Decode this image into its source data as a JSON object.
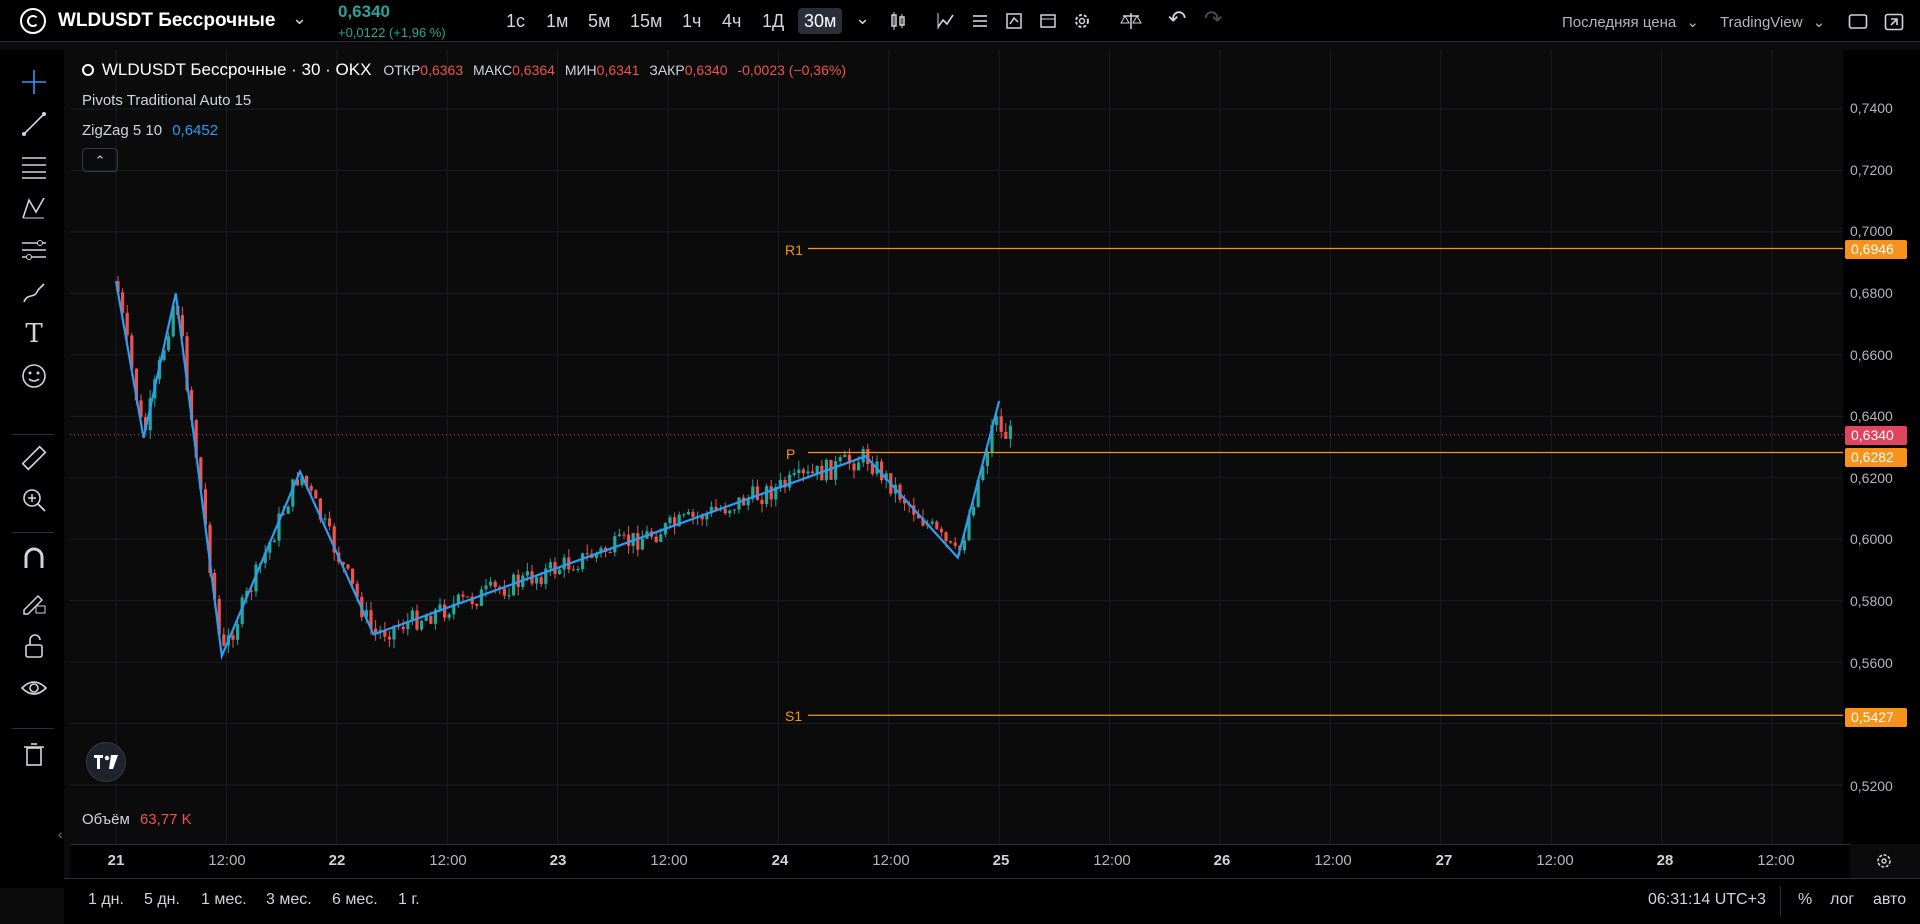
{
  "symbol": {
    "name": "WLDUSDT Бессрочные",
    "price": "0,6340",
    "change": "+0,0122 (+1,96 %)"
  },
  "timeframes": [
    "1с",
    "1м",
    "5м",
    "15м",
    "1ч",
    "4ч",
    "1Д",
    "30м"
  ],
  "active_timeframe": "30м",
  "top_right": {
    "price_type": "Последняя цена",
    "provider": "TradingView"
  },
  "legend": {
    "title": "WLDUSDT Бессрочные · 30 · OKX",
    "open_label": "ОТКР",
    "open": "0,6363",
    "high_label": "МАКС",
    "high": "0,6364",
    "low_label": "МИН",
    "low": "0,6341",
    "close_label": "ЗАКР",
    "close": "0,6340",
    "change": "-0,0023 (−0,36%)",
    "pivots": "Pivots Traditional Auto 15",
    "zigzag_label": "ZigZag 5 10",
    "zigzag_value": "0,6452"
  },
  "volume": {
    "label": "Объём",
    "value": "63,77 K"
  },
  "price_axis": {
    "ticks": [
      "0,7400",
      "0,7200",
      "0,7000",
      "0,6800",
      "0,6600",
      "0,6400",
      "0,6200",
      "0,6000",
      "0,5800",
      "0,5600",
      "0,5200"
    ],
    "current_price_tag": "0,6340",
    "pivot_tags": {
      "R1": "0,6946",
      "P": "0,6282",
      "S1": "0,5427"
    }
  },
  "pivot_labels": {
    "R1": "R1",
    "P": "P",
    "S1": "S1"
  },
  "time_axis": [
    "21",
    "12:00",
    "22",
    "12:00",
    "23",
    "12:00",
    "24",
    "12:00",
    "25",
    "12:00",
    "26",
    "12:00",
    "27",
    "12:00",
    "28",
    "12:00"
  ],
  "ranges": [
    "1 дн.",
    "5 дн.",
    "1 мес.",
    "3 мес.",
    "6 мес.",
    "1 г."
  ],
  "status": {
    "clock": "06:31:14 UTC+3",
    "percent": "%",
    "log": "лог",
    "auto": "авто"
  },
  "colors": {
    "up": "#26a69a",
    "down": "#ef5350",
    "zigzag": "#2a9df4",
    "pivot": "#f7931a",
    "price_tag": "#e0455f"
  },
  "chart_data": {
    "type": "candlestick",
    "zigzag": [
      {
        "t": "21 00:00",
        "price": 0.684
      },
      {
        "t": "21 03:00",
        "price": 0.633
      },
      {
        "t": "21 06:30",
        "price": 0.68
      },
      {
        "t": "21 11:30",
        "price": 0.562
      },
      {
        "t": "21 20:00",
        "price": 0.622
      },
      {
        "t": "22 04:00",
        "price": 0.569
      },
      {
        "t": "24 09:30",
        "price": 0.627
      },
      {
        "t": "24 19:30",
        "price": 0.594
      },
      {
        "t": "25 00:00",
        "price": 0.645
      }
    ],
    "pivots": {
      "R1": 0.6946,
      "P": 0.6282,
      "S1": 0.5427
    },
    "last_price": 0.634
  }
}
